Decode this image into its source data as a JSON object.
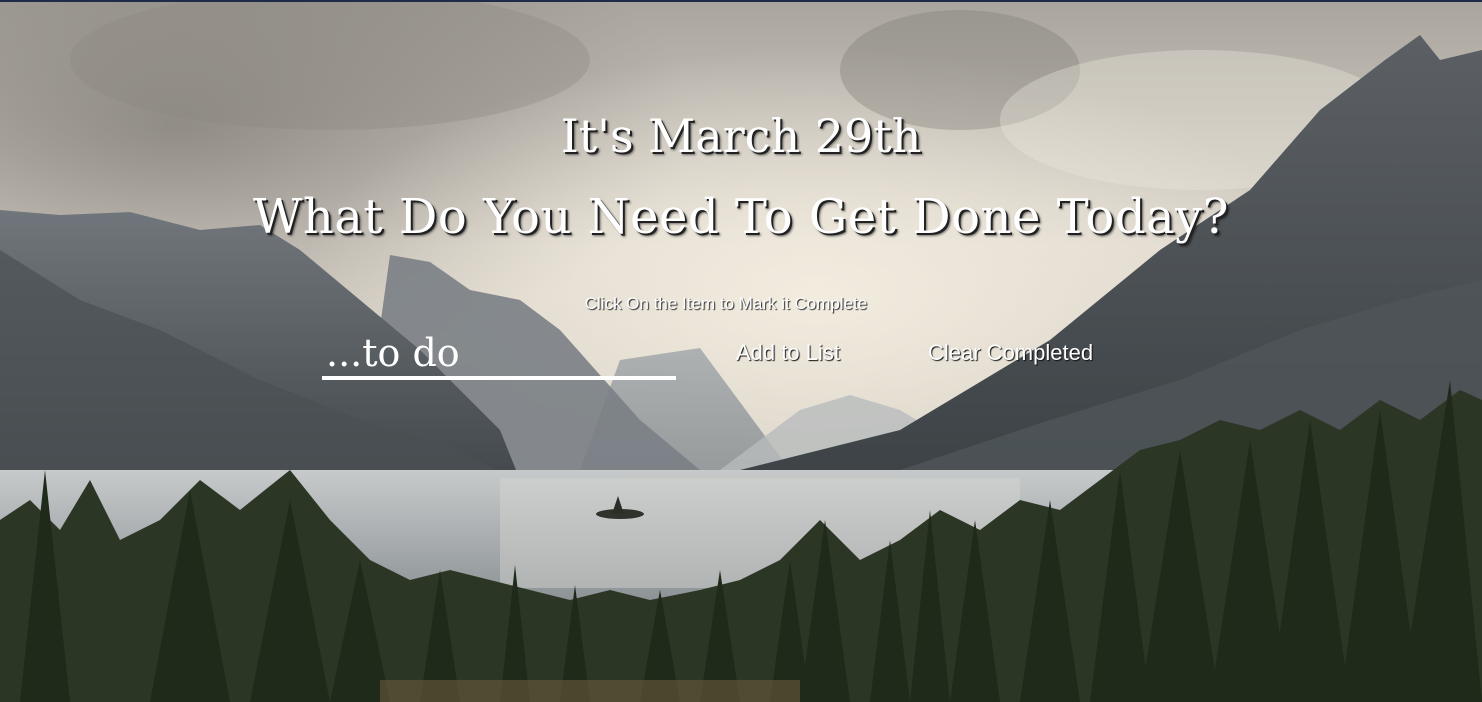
{
  "background": {
    "description_icon": "mountain-lake-background",
    "sky_color": "#d9d2c6",
    "mountain_color": "#5b5f63",
    "lake_color": "#b8bdc0",
    "forest_color": "#26321f"
  },
  "header": {
    "date_text": "It's March 29th",
    "question_text": "What Do You Need To Get Done Today?",
    "instructions_text": "Click On the Item to Mark it Complete"
  },
  "form": {
    "todo_placeholder": "...to do",
    "todo_value": "",
    "add_label": "Add to List",
    "clear_label": "Clear Completed"
  },
  "todos": []
}
